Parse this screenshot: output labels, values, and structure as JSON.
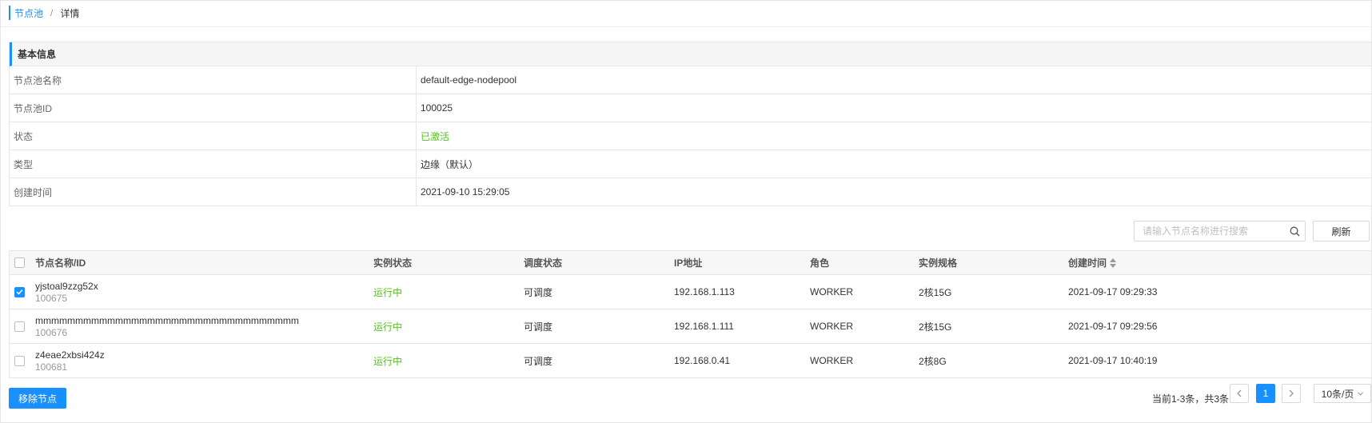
{
  "breadcrumb": {
    "parent": "节点池",
    "separator": "/",
    "current": "详情"
  },
  "basic_info": {
    "title": "基本信息",
    "rows": [
      {
        "label": "节点池名称",
        "value": "default-edge-nodepool"
      },
      {
        "label": "节点池ID",
        "value": "100025"
      },
      {
        "label": "状态",
        "value": "已激活"
      },
      {
        "label": "类型",
        "value": "边缘（默认）"
      },
      {
        "label": "创建时间",
        "value": "2021-09-10 15:29:05"
      }
    ]
  },
  "toolbar": {
    "search_placeholder": "请输入节点名称进行搜索",
    "refresh_label": "刷新",
    "search_icon": "search-icon"
  },
  "table": {
    "columns": [
      "节点名称/ID",
      "实例状态",
      "调度状态",
      "IP地址",
      "角色",
      "实例规格",
      "创建时间"
    ],
    "rows": [
      {
        "checked": true,
        "name": "yjstoal9zzg52x",
        "id": "100675",
        "instance_status": "运行中",
        "schedule_status": "可调度",
        "ip": "192.168.1.113",
        "role": "WORKER",
        "spec": "2核15G",
        "created": "2021-09-17 09:29:33"
      },
      {
        "checked": false,
        "name": "mmmmmmmmmmmmmmmmmmmmmmmmmmmmmmmmm",
        "id": "100676",
        "instance_status": "运行中",
        "schedule_status": "可调度",
        "ip": "192.168.1.111",
        "role": "WORKER",
        "spec": "2核15G",
        "created": "2021-09-17 09:29:56"
      },
      {
        "checked": false,
        "name": "z4eae2xbsi424z",
        "id": "100681",
        "instance_status": "运行中",
        "schedule_status": "可调度",
        "ip": "192.168.0.41",
        "role": "WORKER",
        "spec": "2核8G",
        "created": "2021-09-17 10:40:19"
      }
    ]
  },
  "footer": {
    "remove_label": "移除节点",
    "total_text": "当前1-3条，共3条",
    "current_page": "1",
    "page_size": "10条/页"
  },
  "colors": {
    "accent": "#1890ff",
    "success": "#52c41a"
  }
}
